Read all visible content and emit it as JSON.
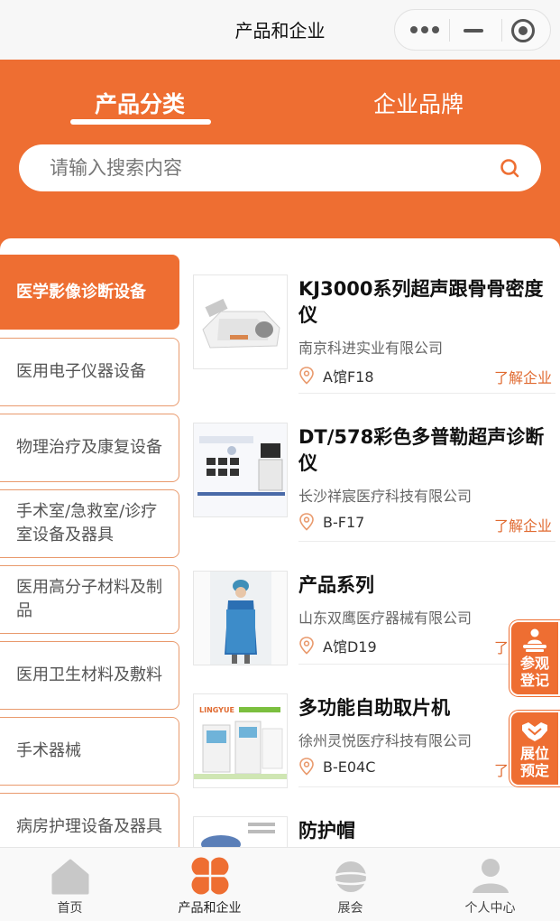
{
  "navbar": {
    "title": "产品和企业"
  },
  "tabs": [
    {
      "label": "产品分类"
    },
    {
      "label": "企业品牌"
    }
  ],
  "search": {
    "placeholder": "请输入搜索内容"
  },
  "categories": [
    {
      "label": "医学影像诊断设备"
    },
    {
      "label": "医用电子仪器设备"
    },
    {
      "label": "物理治疗及康复设备"
    },
    {
      "label": "手术室/急救室/诊疗室设备及器具"
    },
    {
      "label": "医用高分子材料及制品"
    },
    {
      "label": "医用卫生材料及敷料"
    },
    {
      "label": "手术器械"
    },
    {
      "label": "病房护理设备及器具"
    }
  ],
  "products": [
    {
      "name": "KJ3000系列超声跟骨骨密度仪",
      "company": "南京科进实业有限公司",
      "location": "A馆F18",
      "link": "了解企业"
    },
    {
      "name": "DT/578彩色多普勒超声诊断仪",
      "company": "长沙祥宸医疗科技有限公司",
      "location": "B-F17",
      "link": "了解企业"
    },
    {
      "name": "产品系列",
      "company": "山东双鹰医疗器械有限公司",
      "location": "A馆D19",
      "link": "了"
    },
    {
      "name": "多功能自助取片机",
      "company": "徐州灵悦医疗科技有限公司",
      "location": "B-E04C",
      "link": "了"
    },
    {
      "name": "防护帽"
    }
  ],
  "float_buttons": [
    {
      "label": "参观登记"
    },
    {
      "label": "展位预定"
    }
  ],
  "tabbar": [
    {
      "label": "首页",
      "icon": "home-icon"
    },
    {
      "label": "产品和企业",
      "icon": "clover-icon"
    },
    {
      "label": "展会",
      "icon": "planet-icon"
    },
    {
      "label": "个人中心",
      "icon": "user-icon"
    }
  ],
  "colors": {
    "accent": "#ee6e32",
    "link": "#e06a30",
    "inactive_icon": "#c8c8c8"
  }
}
